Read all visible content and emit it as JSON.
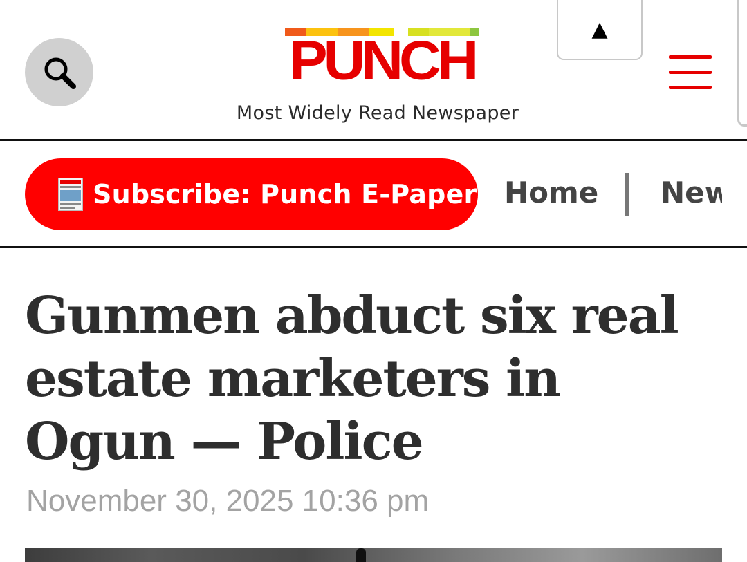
{
  "header": {
    "logo_text": "PUNCH",
    "logo_bar_colors": [
      "#f05a1a",
      "#f7941d",
      "#fcc20f",
      "#f3e500",
      "#d7e021",
      "#8dc63f"
    ],
    "tagline": "Most Widely Read Newspaper",
    "search_icon": "search-icon",
    "scroll_top_symbol": "▲",
    "menu_icon": "hamburger-menu-icon",
    "brand_color": "#e60000"
  },
  "nav": {
    "subscribe_label": "Subscribe: Punch E-Paper",
    "subscribe_icon": "epaper-thumbnail-icon",
    "items": [
      {
        "label": "Home"
      },
      {
        "label": "New"
      }
    ]
  },
  "article": {
    "headline": "Gunmen abduct six real estate marketers in Ogun — Police",
    "date": "November 30, 2025 10:36 pm"
  }
}
